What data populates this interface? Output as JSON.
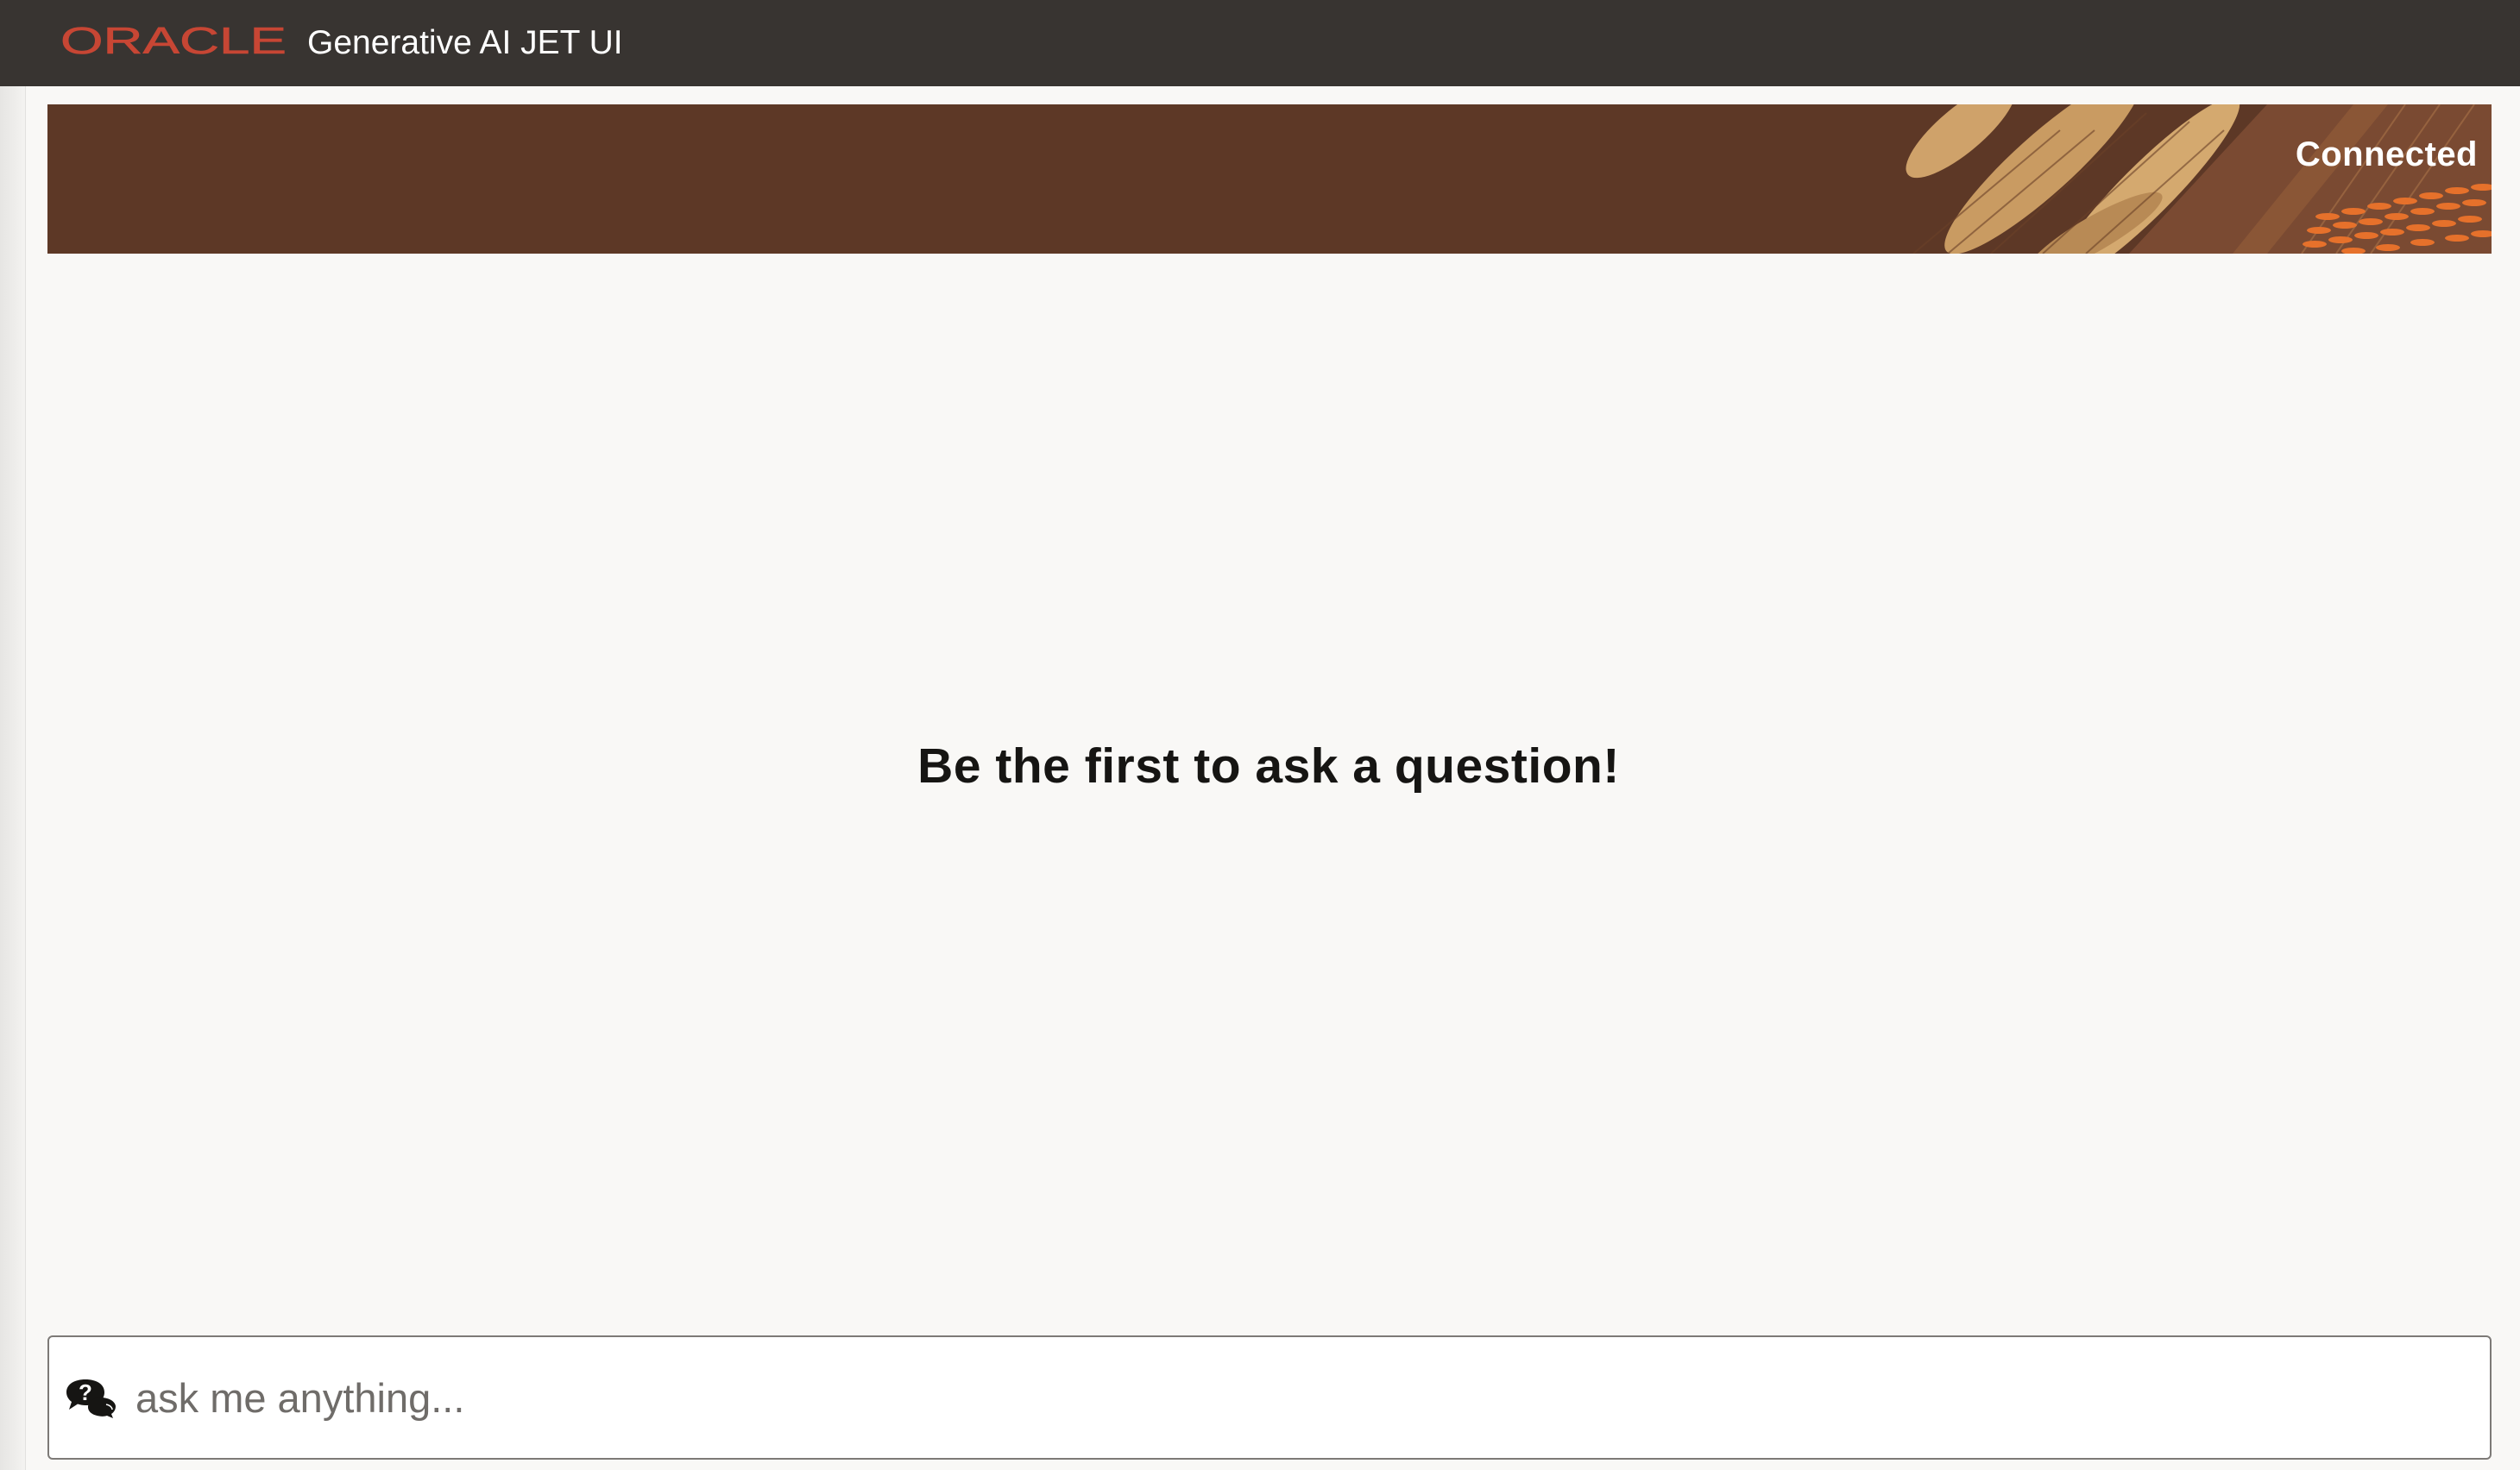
{
  "header": {
    "brand": "ORACLE",
    "app_title": "Generative AI JET UI"
  },
  "banner": {
    "status": "Connected"
  },
  "conversation": {
    "empty_message": "Be the first to ask a question!"
  },
  "prompt": {
    "icon": "chat-bubbles-question-icon",
    "placeholder": "ask me anything...",
    "value": ""
  },
  "colors": {
    "top_bar": "#383431",
    "brand_red": "#c74634",
    "banner_brown": "#5d3826",
    "banner_tan": "#c99b62",
    "banner_orange": "#e6712b",
    "panel_background": "#f9f8f6"
  }
}
